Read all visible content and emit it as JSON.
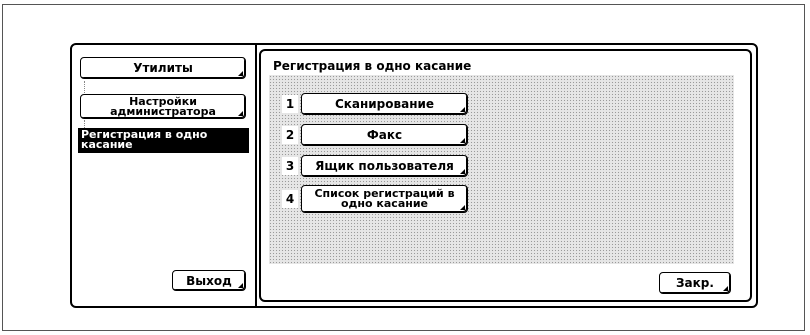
{
  "sidebar": {
    "utilities_label": "Утилиты",
    "admin_label": "Настройки администратора",
    "current_label": "Регистрация в одно касание",
    "exit_label": "Выход"
  },
  "main": {
    "title": "Регистрация в одно касание",
    "items": [
      {
        "num": "1",
        "label": "Сканирование"
      },
      {
        "num": "2",
        "label": "Факс"
      },
      {
        "num": "3",
        "label": "Ящик пользователя"
      },
      {
        "num": "4",
        "label": "Список регистраций в одно касание"
      }
    ],
    "close_label": "Закр."
  }
}
